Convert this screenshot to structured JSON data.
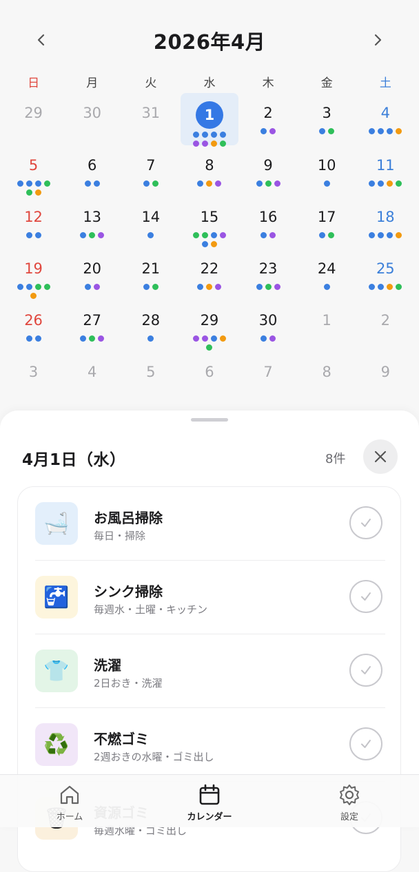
{
  "header": {
    "title": "2026年4月"
  },
  "weekdays": [
    "日",
    "月",
    "火",
    "水",
    "木",
    "金",
    "土"
  ],
  "colors": {
    "blue": "#3b7fe0",
    "purple": "#9a55e3",
    "green": "#2fbf5a",
    "orange": "#f29a11",
    "selected": "#3478e5"
  },
  "calendar": {
    "selected_day": "1",
    "days": [
      {
        "n": "29",
        "other": true,
        "dots": []
      },
      {
        "n": "30",
        "other": true,
        "dots": []
      },
      {
        "n": "31",
        "other": true,
        "dots": []
      },
      {
        "n": "1",
        "selected": true,
        "dots": [
          "blue",
          "blue",
          "blue",
          "blue",
          "purple",
          "purple",
          "orange",
          "green"
        ]
      },
      {
        "n": "2",
        "dots": [
          "blue",
          "purple"
        ]
      },
      {
        "n": "3",
        "dots": [
          "blue",
          "green"
        ]
      },
      {
        "n": "4",
        "dots": [
          "blue",
          "blue",
          "blue",
          "orange"
        ]
      },
      {
        "n": "5",
        "dots": [
          "blue",
          "blue",
          "blue",
          "green",
          "green",
          "orange"
        ]
      },
      {
        "n": "6",
        "dots": [
          "blue",
          "blue"
        ]
      },
      {
        "n": "7",
        "dots": [
          "blue",
          "green"
        ]
      },
      {
        "n": "8",
        "dots": [
          "blue",
          "orange",
          "purple"
        ]
      },
      {
        "n": "9",
        "dots": [
          "blue",
          "green",
          "purple"
        ]
      },
      {
        "n": "10",
        "dots": [
          "blue"
        ]
      },
      {
        "n": "11",
        "dots": [
          "blue",
          "blue",
          "orange",
          "green"
        ]
      },
      {
        "n": "12",
        "dots": [
          "blue",
          "blue"
        ]
      },
      {
        "n": "13",
        "dots": [
          "blue",
          "green",
          "purple"
        ]
      },
      {
        "n": "14",
        "dots": [
          "blue"
        ]
      },
      {
        "n": "15",
        "dots": [
          "green",
          "green",
          "blue",
          "purple",
          "blue",
          "orange"
        ]
      },
      {
        "n": "16",
        "dots": [
          "blue",
          "purple"
        ]
      },
      {
        "n": "17",
        "dots": [
          "blue",
          "green"
        ]
      },
      {
        "n": "18",
        "dots": [
          "blue",
          "blue",
          "blue",
          "orange"
        ]
      },
      {
        "n": "19",
        "dots": [
          "blue",
          "blue",
          "green",
          "green",
          "orange"
        ]
      },
      {
        "n": "20",
        "dots": [
          "blue",
          "purple"
        ]
      },
      {
        "n": "21",
        "dots": [
          "blue",
          "green"
        ]
      },
      {
        "n": "22",
        "dots": [
          "blue",
          "orange",
          "purple"
        ]
      },
      {
        "n": "23",
        "dots": [
          "blue",
          "green",
          "purple"
        ]
      },
      {
        "n": "24",
        "dots": [
          "blue"
        ]
      },
      {
        "n": "25",
        "dots": [
          "blue",
          "blue",
          "orange",
          "green"
        ]
      },
      {
        "n": "26",
        "dots": [
          "blue",
          "blue"
        ]
      },
      {
        "n": "27",
        "dots": [
          "blue",
          "green",
          "purple"
        ]
      },
      {
        "n": "28",
        "dots": [
          "blue"
        ]
      },
      {
        "n": "29",
        "dots": [
          "purple",
          "purple",
          "blue",
          "orange",
          "green"
        ]
      },
      {
        "n": "30",
        "dots": [
          "blue",
          "purple"
        ]
      },
      {
        "n": "1",
        "other": true,
        "dots": []
      },
      {
        "n": "2",
        "other": true,
        "dots": []
      },
      {
        "n": "3",
        "other": true,
        "dots": []
      },
      {
        "n": "4",
        "other": true,
        "dots": []
      },
      {
        "n": "5",
        "other": true,
        "dots": []
      },
      {
        "n": "6",
        "other": true,
        "dots": []
      },
      {
        "n": "7",
        "other": true,
        "dots": []
      },
      {
        "n": "8",
        "other": true,
        "dots": []
      },
      {
        "n": "9",
        "other": true,
        "dots": []
      }
    ]
  },
  "sheet": {
    "title": "4月1日（水）",
    "count": "8件",
    "tasks": [
      {
        "name": "お風呂掃除",
        "sub": "毎日・掃除",
        "icon": "🛁",
        "tile": "#e3effb"
      },
      {
        "name": "シンク掃除",
        "sub": "毎週水・土曜・キッチン",
        "icon": "🚰",
        "tile": "#fdf5dd"
      },
      {
        "name": "洗濯",
        "sub": "2日おき・洗濯",
        "icon": "👕",
        "tile": "#e3f5e7"
      },
      {
        "name": "不燃ゴミ",
        "sub": "2週おきの水曜・ゴミ出し",
        "icon": "♻️",
        "tile": "#f1e6f8"
      },
      {
        "name": "資源ゴミ",
        "sub": "毎週水曜・ゴミ出し",
        "icon": "🗑",
        "tile": "#fbf0dd"
      }
    ]
  },
  "tabbar": {
    "home": "ホーム",
    "calendar": "カレンダー",
    "settings": "設定"
  }
}
